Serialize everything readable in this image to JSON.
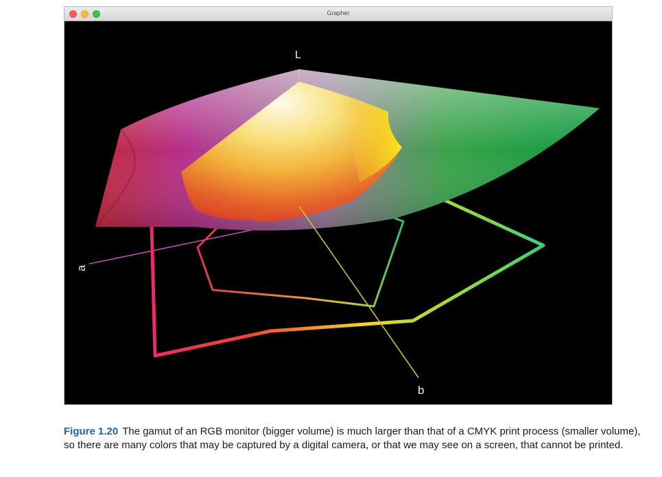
{
  "window": {
    "title": "Grapher"
  },
  "plot": {
    "axis_labels": {
      "l": "L",
      "a": "a",
      "b": "b"
    }
  },
  "caption": {
    "figure_label": "Figure 1.20",
    "text": "The gamut of an RGB monitor (bigger volume) is much larger than that of a CMYK print process (smaller volume), so there are many colors that may be captured by a digital camera, or that we may see on a screen, that cannot be printed."
  }
}
